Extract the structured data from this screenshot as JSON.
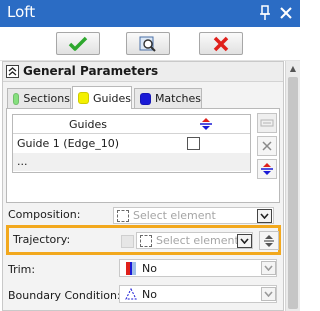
{
  "window": {
    "title": "Loft"
  },
  "icons": {
    "pin": "pin-icon",
    "close": "close-icon",
    "ok": "check-icon",
    "preview": "preview-icon",
    "cancel": "cancel-icon",
    "collapse": "collapse-icon",
    "dropdown": "chevron-down-icon"
  },
  "colors": {
    "titlebar": "#2b6cc4",
    "ok_green": "#2ea82e",
    "cancel_red": "#e0201b",
    "highlight": "#f2a81d",
    "sections_swatch": "#86e07e",
    "guides_swatch": "#f4f000",
    "matches_swatch": "#1a1ad6"
  },
  "section": {
    "title": "General Parameters"
  },
  "tabs": [
    {
      "label": "Sections",
      "active": false
    },
    {
      "label": "Guides",
      "active": true
    },
    {
      "label": "Matches",
      "active": false
    }
  ],
  "guides_table": {
    "header": "Guides",
    "rows": [
      {
        "name": "Guide 1 (Edge_10)",
        "checked": false
      },
      {
        "name": "...",
        "checked": false
      }
    ]
  },
  "composition": {
    "label": "Composition:",
    "placeholder": "Select element"
  },
  "trajectory": {
    "label": "Trajectory:",
    "placeholder": "Select element"
  },
  "trim": {
    "label": "Trim:",
    "value": "No"
  },
  "boundary_condition": {
    "label": "Boundary Condition:",
    "value": "No"
  }
}
